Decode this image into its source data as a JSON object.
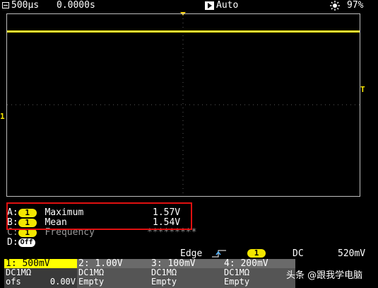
{
  "status_bar": {
    "timebase": "500µs",
    "delay": "0.0000s",
    "run_mode": "Auto",
    "battery": "97%"
  },
  "markers": {
    "ch1": "1",
    "trigger_level": "T"
  },
  "measurements": [
    {
      "slot": "A:",
      "channel": "1",
      "name": "Maximum",
      "value": "1.57V"
    },
    {
      "slot": "B:",
      "channel": "1",
      "name": "Mean",
      "value": "1.54V"
    },
    {
      "slot": "C:",
      "channel": "1",
      "name": "Frequency",
      "value": "*********"
    },
    {
      "slot": "D:",
      "state": "Off"
    }
  ],
  "trigger": {
    "type": "Edge",
    "source": "1",
    "coupling": "DC",
    "level": "520mV"
  },
  "channels": [
    {
      "head": "1: 500mV",
      "line1": "DC1MΩ",
      "line2_left": "ofs",
      "line2_right": "0.00V"
    },
    {
      "head": "2: 1.00V",
      "line1": "DC1MΩ",
      "line2_left": "Empty",
      "line2_right": ""
    },
    {
      "head": "3: 100mV",
      "line1": "DC1MΩ",
      "line2_left": "Empty",
      "line2_right": ""
    },
    {
      "head": "4: 200mV",
      "line1": "DC1MΩ",
      "line2_left": "Empty",
      "line2_right": ""
    }
  ],
  "watermark": "头条 @跟我学电脑",
  "colors": {
    "ch1": "#ffff00",
    "trace": "#f2e600",
    "highlight_box": "#e01010"
  }
}
